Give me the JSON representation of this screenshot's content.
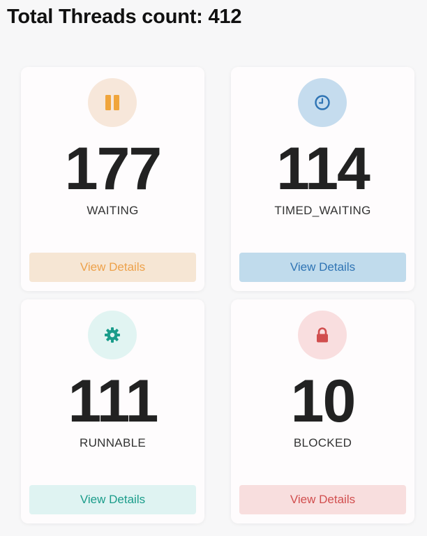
{
  "header": {
    "title": "Total Threads count: 412"
  },
  "cards": [
    {
      "count": "177",
      "state": "WAITING",
      "button": "View Details",
      "icon": "pause-icon",
      "accent": "#f0a53c"
    },
    {
      "count": "114",
      "state": "TIMED_WAITING",
      "button": "View Details",
      "icon": "clock-icon",
      "accent": "#2f74b4"
    },
    {
      "count": "111",
      "state": "RUNNABLE",
      "button": "View Details",
      "icon": "gear-icon",
      "accent": "#1a9c8a"
    },
    {
      "count": "10",
      "state": "BLOCKED",
      "button": "View Details",
      "icon": "lock-icon",
      "accent": "#d14e4e"
    }
  ]
}
